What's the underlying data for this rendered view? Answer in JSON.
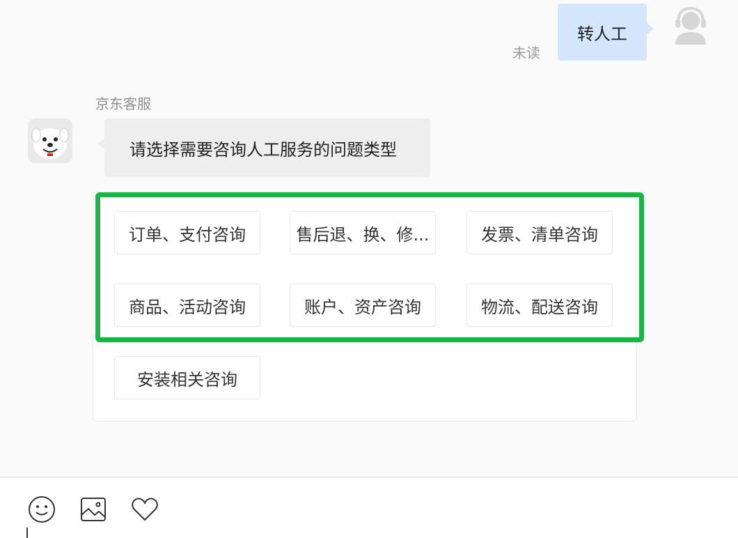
{
  "outgoing_message": {
    "text": "转人工",
    "status": "未读",
    "bubble_color": "#d3e6fc",
    "avatar_icon": "agent-headset-icon"
  },
  "incoming_message": {
    "sender": "京东客服",
    "text": "请选择需要咨询人工服务的问题类型",
    "avatar_icon": "jd-joy-dog-icon"
  },
  "options": [
    {
      "label": "订单、支付咨询"
    },
    {
      "label": "售后退、换、修..."
    },
    {
      "label": "发票、清单咨询"
    },
    {
      "label": "商品、活动咨询"
    },
    {
      "label": "账户、资产咨询"
    },
    {
      "label": "物流、配送咨询"
    },
    {
      "label": "安装相关咨询"
    }
  ],
  "highlight_color": "#1cb447",
  "toolbar": {
    "icons": [
      "emoji-icon",
      "image-icon",
      "heart-icon"
    ]
  }
}
